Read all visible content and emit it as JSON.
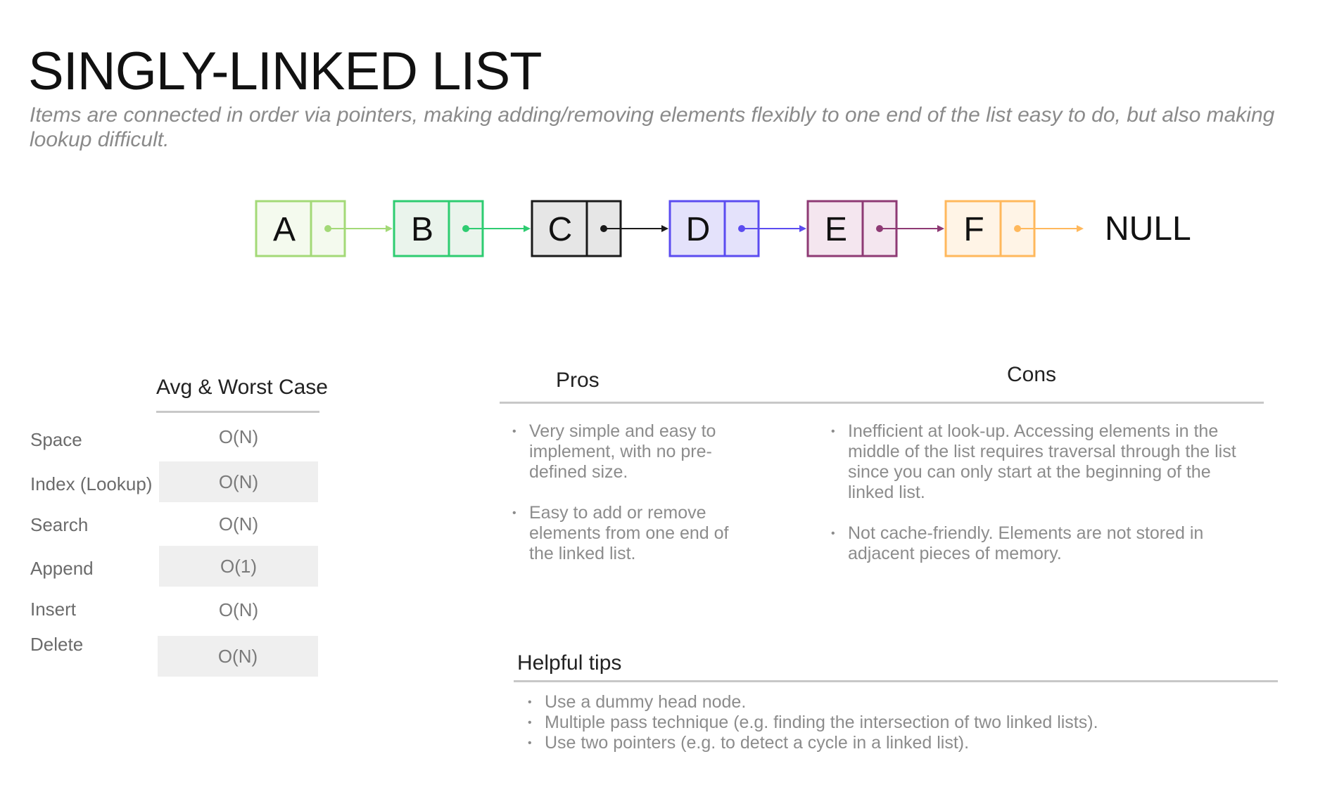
{
  "header": {
    "title": "SINGLY-LINKED LIST",
    "subtitle": "Items are connected in order via pointers, making adding/removing elements flexibly to one end of the list easy to do, but also making lookup difficult."
  },
  "diagram": {
    "nodes": [
      {
        "label": "A",
        "stroke": "#a3d977",
        "fill": "#f4faee"
      },
      {
        "label": "B",
        "stroke": "#2ecc71",
        "fill": "#eaf4ec"
      },
      {
        "label": "C",
        "stroke": "#1a1a1a",
        "fill": "#e6e6e6"
      },
      {
        "label": "D",
        "stroke": "#5b4cf0",
        "fill": "#e4e2fb"
      },
      {
        "label": "E",
        "stroke": "#8e3a74",
        "fill": "#f4e6ef"
      },
      {
        "label": "F",
        "stroke": "#ffb85c",
        "fill": "#fff4e6"
      }
    ],
    "terminal": "NULL"
  },
  "complexity": {
    "header": "Avg & Worst Case",
    "rows": [
      {
        "label": "Space",
        "value": "O(N)"
      },
      {
        "label": "Index (Lookup)",
        "value": "O(N)"
      },
      {
        "label": "Search",
        "value": "O(N)"
      },
      {
        "label": "Append",
        "value": "O(1)"
      },
      {
        "label": "Insert",
        "value": "O(N)"
      },
      {
        "label": "Delete",
        "value": "O(N)"
      }
    ]
  },
  "pros": {
    "heading": "Pros",
    "items": [
      "Very simple and easy to implement, with no pre-defined size.",
      "Easy to add or remove elements from one end of the linked list."
    ]
  },
  "cons": {
    "heading": "Cons",
    "items": [
      "Inefficient at look-up. Accessing elements in the middle of the list requires traversal through the list since you can only start at the beginning of the linked list.",
      "Not cache-friendly. Elements are not stored in adjacent pieces of memory."
    ]
  },
  "tips": {
    "heading": "Helpful tips",
    "items": [
      "Use a dummy head node.",
      "Multiple pass technique (e.g. finding the intersection of two linked lists).",
      "Use two pointers (e.g. to detect a cycle in a linked list)."
    ]
  }
}
